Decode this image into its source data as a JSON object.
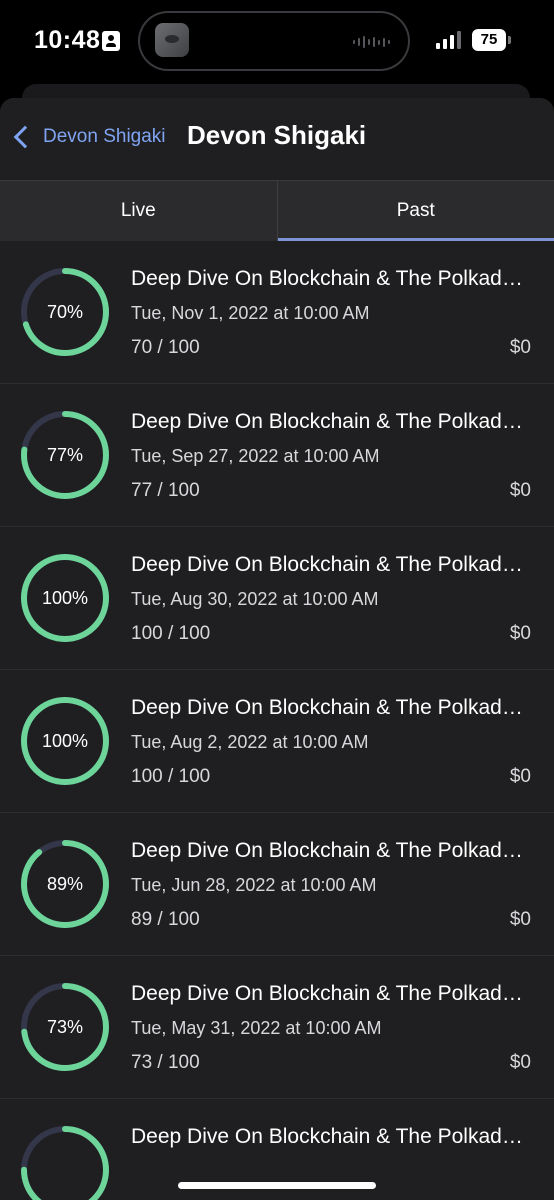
{
  "status_bar": {
    "time": "10:48",
    "battery": "75"
  },
  "nav": {
    "back_label": "Devon Shigaki",
    "title": "Devon Shigaki"
  },
  "tabs": [
    {
      "label": "Live",
      "active": false
    },
    {
      "label": "Past",
      "active": true
    }
  ],
  "colors": {
    "ring_fill": "#6dd49a",
    "ring_track": "#34364a",
    "accent": "#7fa4f2",
    "tab_indicator": "#7d94d6"
  },
  "events": [
    {
      "title": "Deep Dive On Blockchain & The Polkadot Ecosystem",
      "date": "Tue, Nov 1, 2022 at 10:00 AM",
      "count": "70 / 100",
      "price": "$0",
      "percent_label": "70%",
      "progress": 0.7
    },
    {
      "title": "Deep Dive On Blockchain & The Polkadot Ecosystem",
      "date": "Tue, Sep 27, 2022 at 10:00 AM",
      "count": "77 / 100",
      "price": "$0",
      "percent_label": "77%",
      "progress": 0.77
    },
    {
      "title": "Deep Dive On Blockchain & The Polkadot Ecosystem",
      "date": "Tue, Aug 30, 2022 at 10:00 AM",
      "count": "100 / 100",
      "price": "$0",
      "percent_label": "100%",
      "progress": 1.0
    },
    {
      "title": "Deep Dive On Blockchain & The Polkadot Ecosystem",
      "date": "Tue, Aug 2, 2022 at 10:00 AM",
      "count": "100 / 100",
      "price": "$0",
      "percent_label": "100%",
      "progress": 1.0
    },
    {
      "title": "Deep Dive On Blockchain & The Polkadot Ecosystem",
      "date": "Tue, Jun 28, 2022 at 10:00 AM",
      "count": "89 / 100",
      "price": "$0",
      "percent_label": "89%",
      "progress": 0.89
    },
    {
      "title": "Deep Dive On Blockchain & The Polkadot Ecosystem",
      "date": "Tue, May 31, 2022 at 10:00 AM",
      "count": "73 / 100",
      "price": "$0",
      "percent_label": "73%",
      "progress": 0.73
    },
    {
      "title": "Deep Dive On Blockchain & The Polkadot Ecosystem",
      "date": "",
      "count": "",
      "price": "",
      "percent_label": "",
      "progress": 0.75
    }
  ]
}
